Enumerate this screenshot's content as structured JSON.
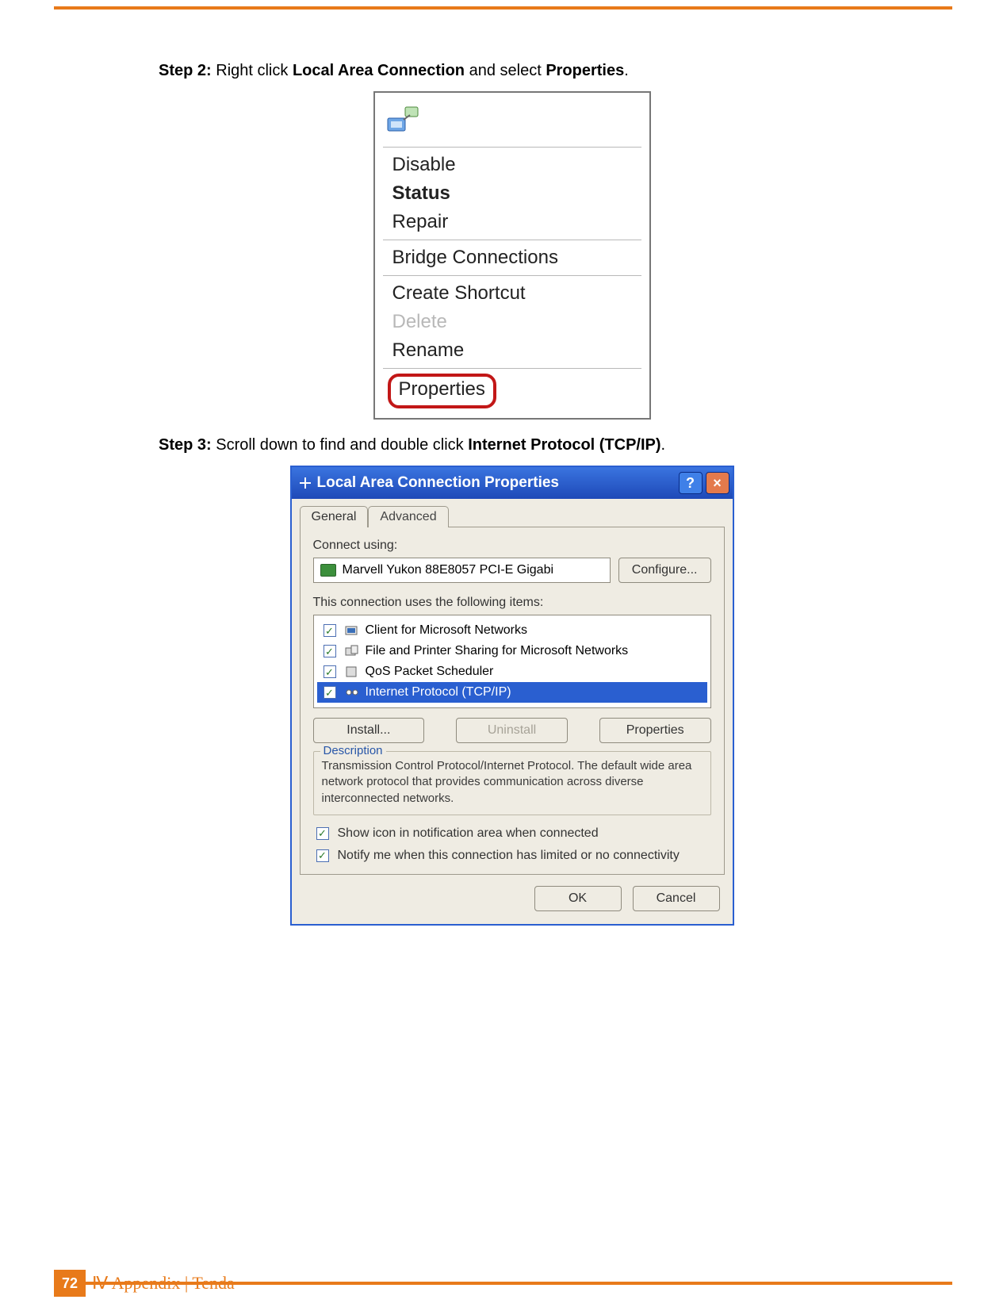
{
  "step2": {
    "prefix": "Step 2:",
    "mid": " Right click ",
    "b1": "Local Area Connection",
    "mid2": " and select ",
    "b2": "Properties",
    "end": "."
  },
  "ctx": {
    "items": [
      "Disable",
      "Status",
      "Repair",
      "Bridge Connections",
      "Create Shortcut",
      "Delete",
      "Rename"
    ],
    "properties": "Properties"
  },
  "step3": {
    "prefix": "Step 3:",
    "mid": " Scroll down to find and double click ",
    "b1": "Internet Protocol (TCP/IP)",
    "end": "."
  },
  "dlg": {
    "title": "Local Area Connection Properties",
    "help": "?",
    "close": "×",
    "tabs": {
      "general": "General",
      "advanced": "Advanced"
    },
    "connect_using": "Connect using:",
    "adapter": "Marvell Yukon 88E8057 PCI-E Gigabi",
    "configure": "Configure...",
    "items_label": "This connection uses the following items:",
    "items": [
      {
        "label": "Client for Microsoft Networks",
        "checked": true,
        "sel": false
      },
      {
        "label": "File and Printer Sharing for Microsoft Networks",
        "checked": true,
        "sel": false
      },
      {
        "label": "QoS Packet Scheduler",
        "checked": true,
        "sel": false
      },
      {
        "label": "Internet Protocol (TCP/IP)",
        "checked": true,
        "sel": true
      }
    ],
    "install": "Install...",
    "uninstall": "Uninstall",
    "properties": "Properties",
    "desc_title": "Description",
    "desc": "Transmission Control Protocol/Internet Protocol. The default wide area network protocol that provides communication across diverse interconnected networks.",
    "opt1": "Show icon in notification area when connected",
    "opt2": "Notify me when this connection has limited or no connectivity",
    "ok": "OK",
    "cancel": "Cancel"
  },
  "footer": {
    "page": "72",
    "section": "Ⅳ Appendix",
    "brand": " | Tenda"
  }
}
